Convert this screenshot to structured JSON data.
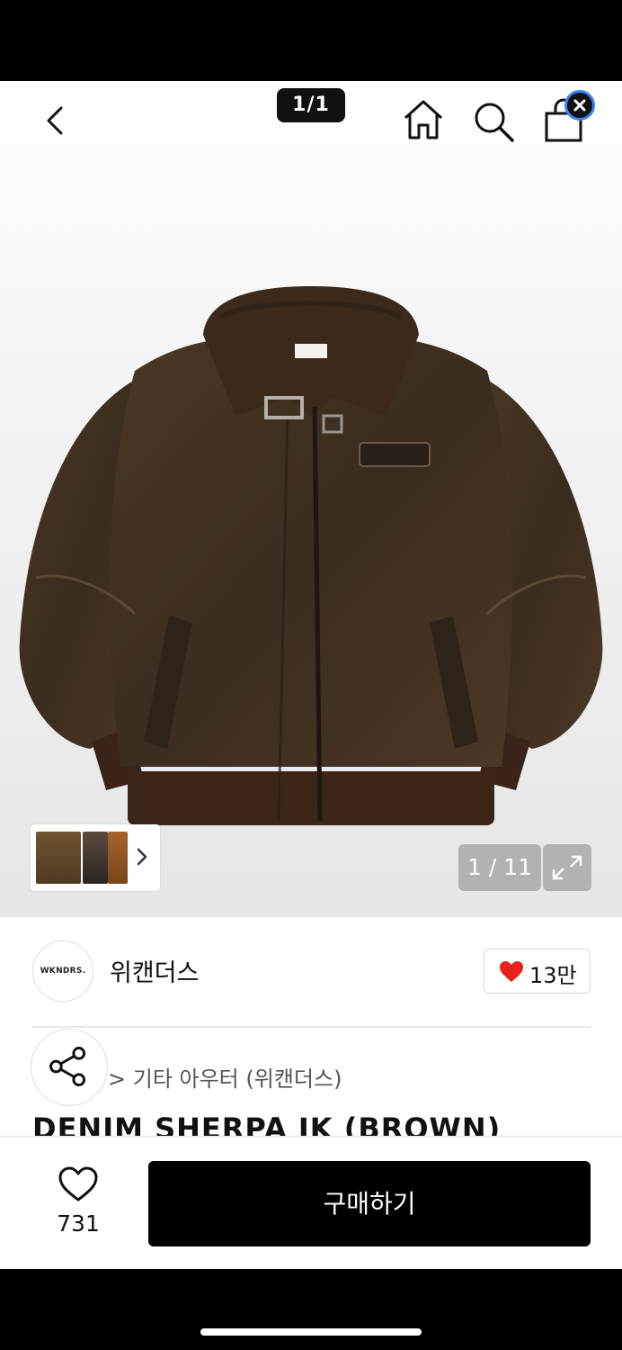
{
  "header": {
    "page_indicator": "1/1"
  },
  "gallery": {
    "counter": "1 / 11"
  },
  "brand": {
    "logo_text": "WKNDRS.",
    "name": "위캔더스",
    "likes": "13만"
  },
  "product": {
    "breadcrumb": "> 기타 아우터 (위캔더스)",
    "title": "DENIM SHERPA JK (BROWN)"
  },
  "footer": {
    "wishlist_count": "731",
    "buy_label": "구매하기"
  },
  "colors": {
    "like_heart": "#e8211b",
    "buy_button": "#000000",
    "jacket": "#3d2e20"
  }
}
